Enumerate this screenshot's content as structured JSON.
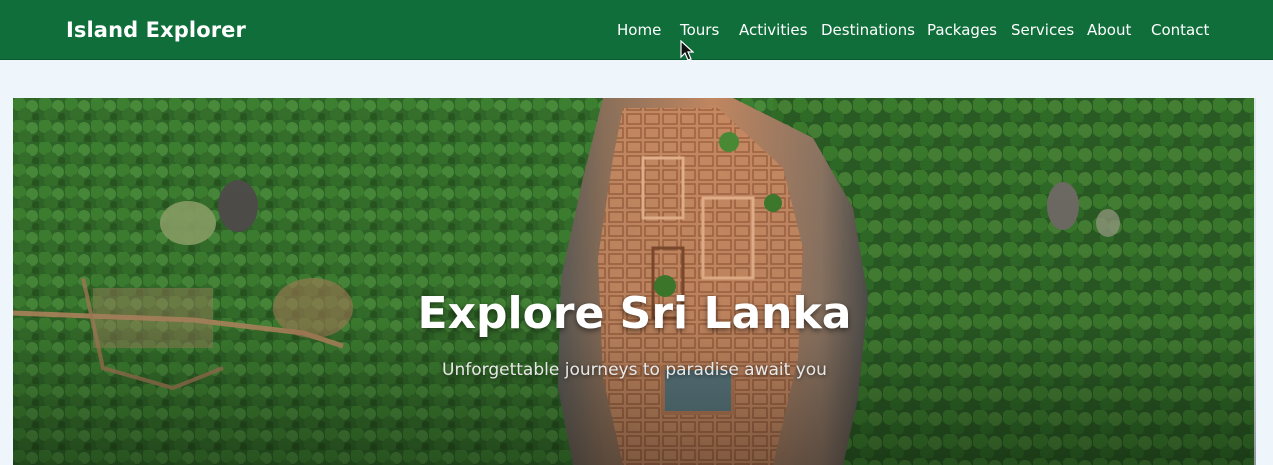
{
  "header": {
    "brand": "Island Explorer",
    "background_color": "#0f6e3a",
    "nav": [
      {
        "label": "Home"
      },
      {
        "label": "Tours"
      },
      {
        "label": "Activities"
      },
      {
        "label": "Destinations"
      },
      {
        "label": "Packages"
      },
      {
        "label": "Services"
      },
      {
        "label": "About"
      },
      {
        "label": "Contact"
      }
    ]
  },
  "hero": {
    "title": "Explore Sri Lanka",
    "subtitle": "Unforgettable journeys to paradise await you",
    "image_icon": "aerial-forest-rock-fortress-image"
  },
  "page": {
    "background_color": "#eef5fb"
  }
}
